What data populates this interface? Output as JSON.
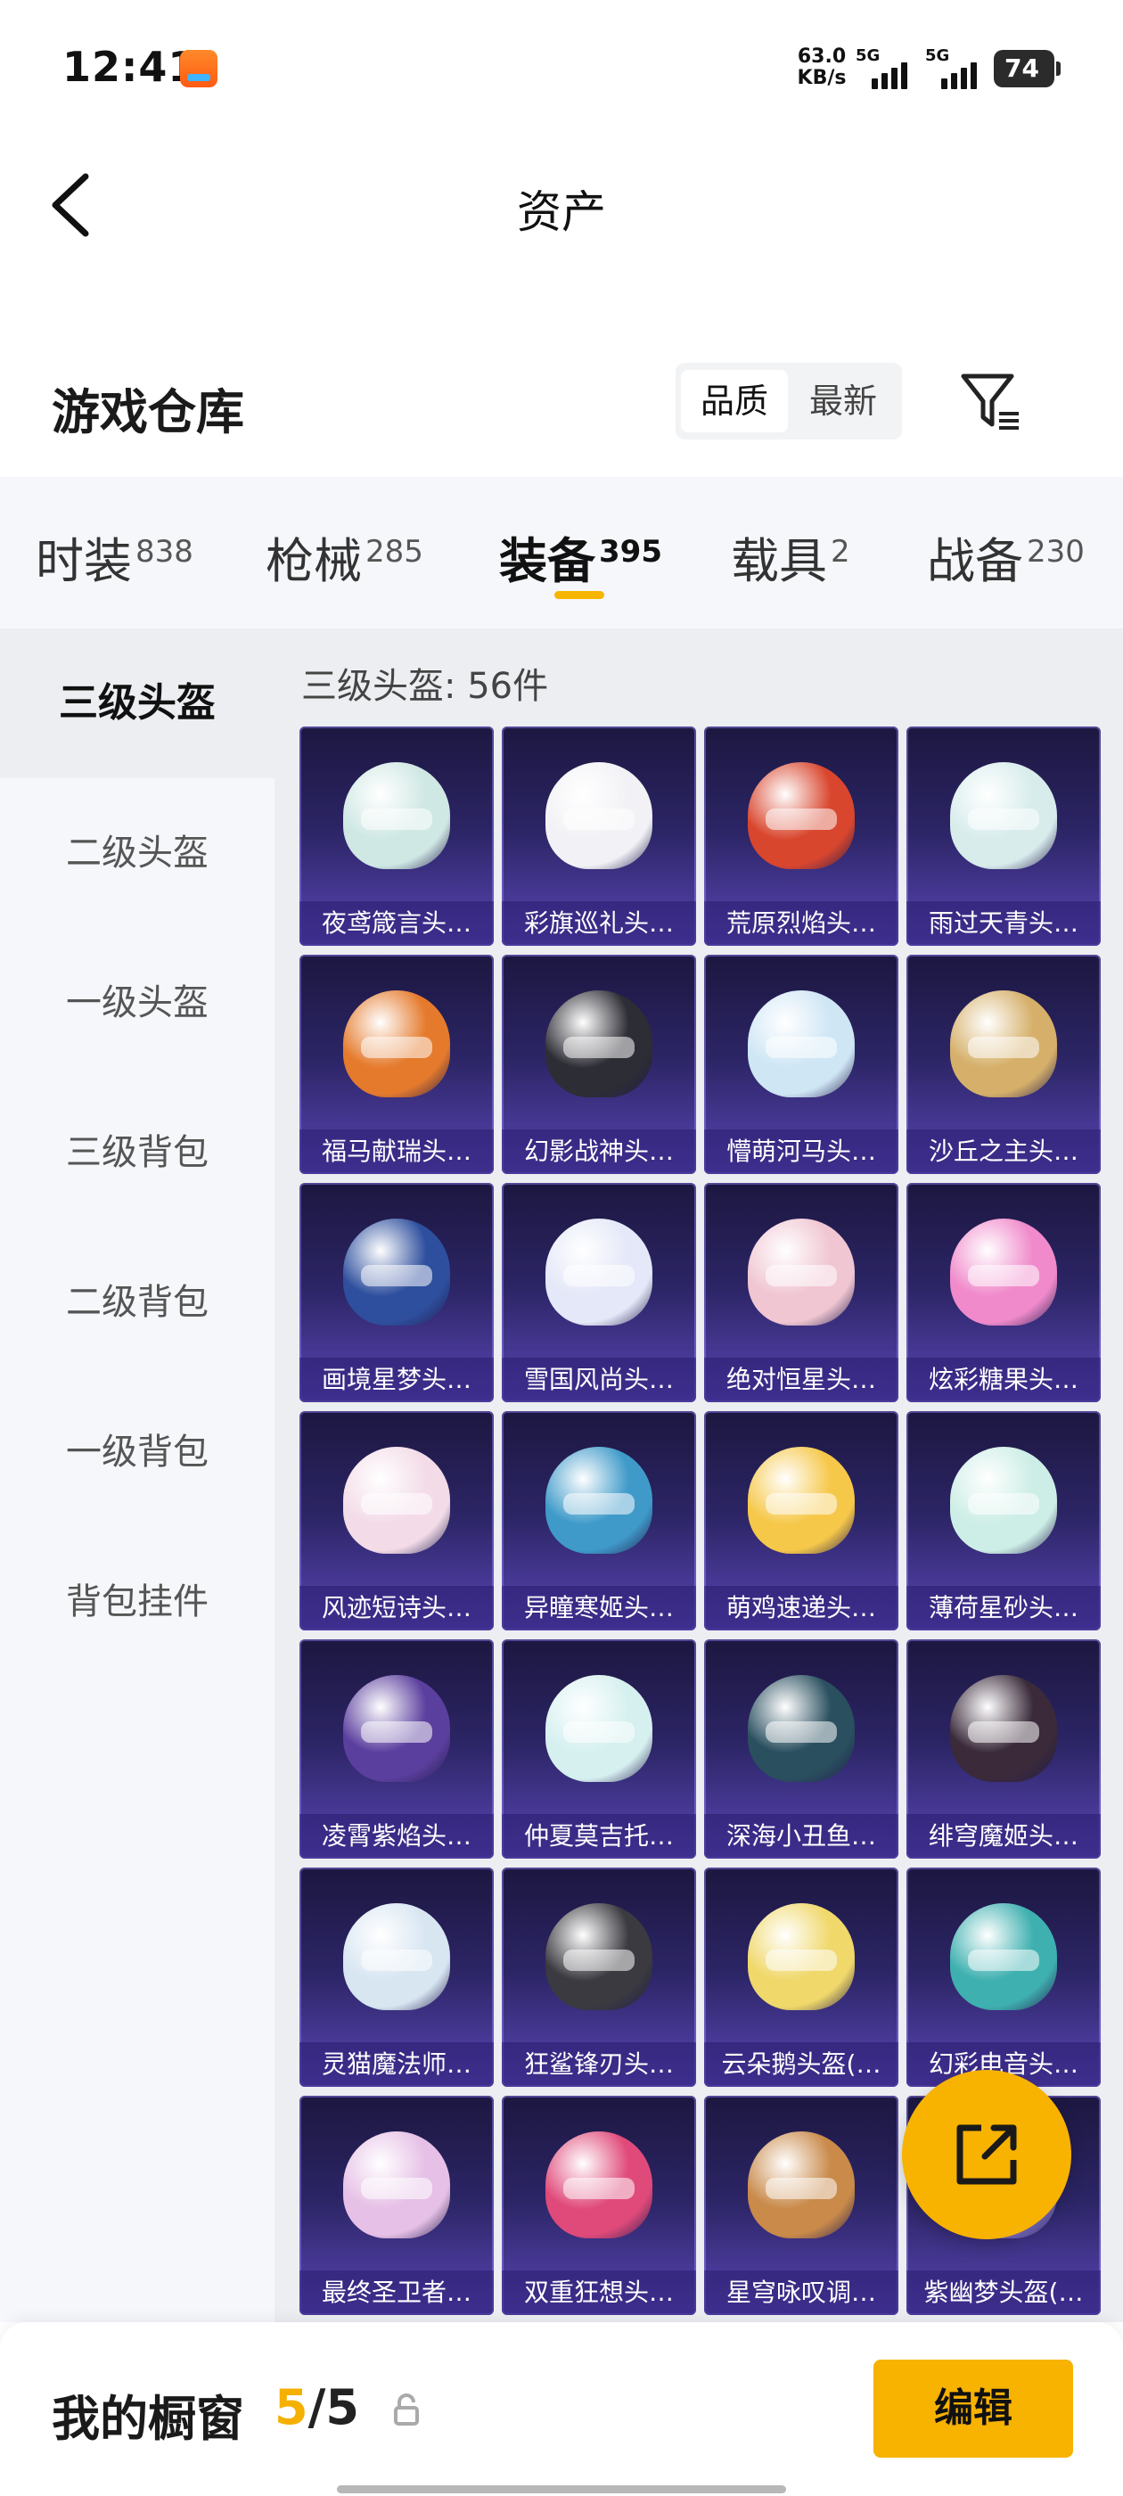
{
  "status_bar": {
    "time": "12:41",
    "speed_value": "63.0",
    "speed_unit": "KB/s",
    "signal1": "5G",
    "signal2": "5G",
    "battery": "74"
  },
  "nav": {
    "title": "资产",
    "back_icon": "chevron-left-icon"
  },
  "header": {
    "title": "游戏仓库",
    "sort_options": [
      "品质",
      "最新"
    ],
    "sort_selected": "品质",
    "filter_icon": "filter-icon"
  },
  "tabs": [
    {
      "label": "时装",
      "count": "838"
    },
    {
      "label": "枪械",
      "count": "285"
    },
    {
      "label": "装备",
      "count": "395"
    },
    {
      "label": "载具",
      "count": "2"
    },
    {
      "label": "战备",
      "count": "230"
    }
  ],
  "active_tab": "装备",
  "accent_color": "#f8b200",
  "sidebar": {
    "items": [
      "三级头盔",
      "二级头盔",
      "一级头盔",
      "三级背包",
      "二级背包",
      "一级背包",
      "背包挂件"
    ],
    "active": "三级头盔"
  },
  "content": {
    "title": "三级头盔: 56件",
    "items": [
      "夜鸢箴言头…",
      "彩旗巡礼头…",
      "荒原烈焰头…",
      "雨过天青头…",
      "福马献瑞头…",
      "幻影战神头…",
      "懵萌河马头…",
      "沙丘之主头…",
      "画境星梦头…",
      "雪国风尚头…",
      "绝对恒星头…",
      "炫彩糖果头…",
      "风迹短诗头…",
      "异瞳寒姬头…",
      "萌鸡速递头…",
      "薄荷星砂头…",
      "凌霄紫焰头…",
      "仲夏莫吉托…",
      "深海小丑鱼…",
      "绯穹魔姬头…",
      "灵猫魔法师…",
      "狂鲨锋刃头…",
      "云朵鹅头盔(…",
      "幻彩电音头…",
      "最终圣卫者…",
      "双重狂想头…",
      "星穹咏叹调…",
      "紫幽梦头盔(…"
    ]
  },
  "fab": {
    "icon": "share-export-icon"
  },
  "bottom_bar": {
    "label": "我的橱窗",
    "current": "5",
    "separator": "/",
    "total": "5",
    "lock_icon": "lock-icon",
    "edit_label": "编辑"
  }
}
